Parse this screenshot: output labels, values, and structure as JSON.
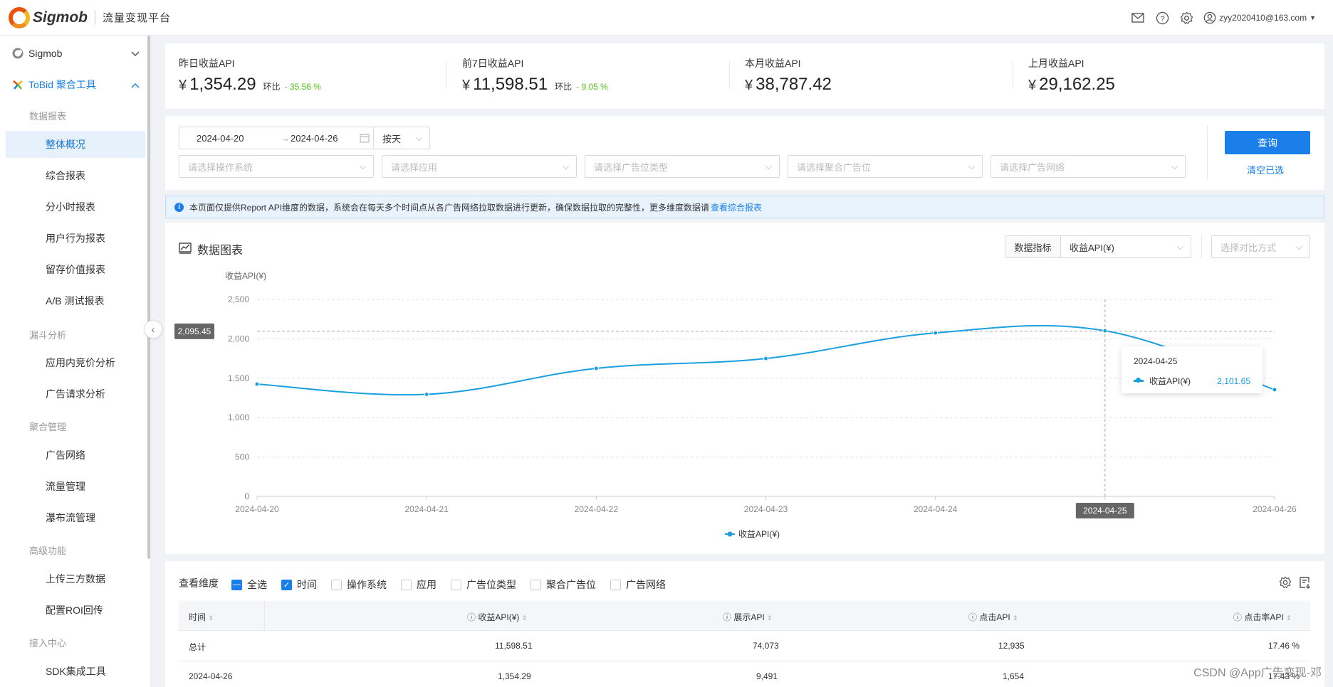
{
  "header": {
    "brand": "Sigmob",
    "platform": "流量变现平台",
    "user_email": "zyy2020410@163.com"
  },
  "sidebar": {
    "group_sigmob": "Sigmob",
    "group_tobid": "ToBid 聚合工具",
    "sections": [
      "数据报表",
      "漏斗分析",
      "聚合管理",
      "高级功能",
      "接入中心"
    ],
    "items": [
      "整体概况",
      "综合报表",
      "分小时报表",
      "用户行为报表",
      "留存价值报表",
      "A/B 测试报表",
      "应用内竞价分析",
      "广告请求分析",
      "广告网络",
      "流量管理",
      "瀑布流管理",
      "上传三方数据",
      "配置ROI回传",
      "SDK集成工具"
    ]
  },
  "stats": [
    {
      "label": "昨日收益API",
      "currency": "¥",
      "value": "1,354.29",
      "compare_label": "环比",
      "compare_value": "- 35.56 %"
    },
    {
      "label": "前7日收益API",
      "currency": "¥",
      "value": "11,598.51",
      "compare_label": "环比",
      "compare_value": "- 9.05 %"
    },
    {
      "label": "本月收益API",
      "currency": "¥",
      "value": "38,787.42"
    },
    {
      "label": "上月收益API",
      "currency": "¥",
      "value": "29,162.25"
    }
  ],
  "filters": {
    "date_start": "2024-04-20",
    "date_end": "2024-04-26",
    "granularity": "按天",
    "os_placeholder": "请选择操作系统",
    "app_placeholder": "请选择应用",
    "adtype_placeholder": "请选择广告位类型",
    "adunit_placeholder": "请选择聚合广告位",
    "network_placeholder": "请选择广告网络",
    "query_label": "查询",
    "clear_label": "清空已选"
  },
  "notice": {
    "text": "本页面仅提供Report API维度的数据，系统会在每天多个时间点从各广告网络拉取数据进行更新，确保数据拉取的完整性，更多维度数据请",
    "link": "查看综合报表"
  },
  "chart_panel": {
    "title": "数据图表",
    "metric_label": "数据指标",
    "metric_value": "收益API(¥)",
    "compare_placeholder": "选择对比方式",
    "crosshair_value": "2,095.45",
    "crosshair_date": "2024-04-25",
    "tooltip": {
      "date": "2024-04-25",
      "series": "收益API(¥)",
      "value": "2,101.65"
    }
  },
  "chart_data": {
    "type": "line",
    "ylabel": "收益API(¥)",
    "ylim": [
      0,
      2500
    ],
    "yticks": [
      "0",
      "500",
      "1,000",
      "1,500",
      "2,000",
      "2,500"
    ],
    "categories": [
      "2024-04-20",
      "2024-04-21",
      "2024-04-22",
      "2024-04-23",
      "2024-04-24",
      "2024-04-25",
      "2024-04-26"
    ],
    "series": [
      {
        "name": "收益API(¥)",
        "values": [
          1425,
          1295,
          1625,
          1750,
          2075,
          2101.65,
          1354.29
        ],
        "color": "#1a9fe0"
      }
    ],
    "legend": "bottom-center",
    "grid": true
  },
  "table": {
    "dimension_label": "查看维度",
    "dimensions": [
      {
        "label": "全选",
        "state": "partial"
      },
      {
        "label": "时间",
        "state": "checked"
      },
      {
        "label": "操作系统",
        "state": "unchecked"
      },
      {
        "label": "应用",
        "state": "unchecked"
      },
      {
        "label": "广告位类型",
        "state": "unchecked"
      },
      {
        "label": "聚合广告位",
        "state": "unchecked"
      },
      {
        "label": "广告网络",
        "state": "unchecked"
      }
    ],
    "columns": [
      "时间",
      "收益API(¥)",
      "展示API",
      "点击API",
      "点击率API"
    ],
    "rows": [
      [
        "总计",
        "11,598.51",
        "74,073",
        "12,935",
        "17.46 %"
      ],
      [
        "2024-04-26",
        "1,354.29",
        "9,491",
        "1,654",
        "17.43 %"
      ]
    ]
  },
  "watermark": "CSDN @App广告变现-邓"
}
